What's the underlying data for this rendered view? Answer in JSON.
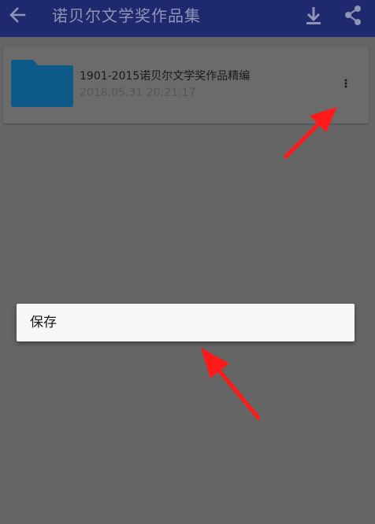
{
  "appbar": {
    "title": "诺贝尔文学奖作品集",
    "back_icon": "arrow-left-icon",
    "download_icon": "download-icon",
    "share_icon": "share-icon"
  },
  "file_item": {
    "icon": "folder-icon",
    "name": "1901-2015诺贝尔文学奖作品精编",
    "date": "2018.05.31 20:21:17",
    "more_icon": "more-vert-icon"
  },
  "context_menu": {
    "items": [
      {
        "label": "保存"
      }
    ]
  },
  "colors": {
    "appbar": "#1f2a6e",
    "scrim_background": "#656565",
    "folder": "#0d5a88",
    "annotation_arrow": "#ff1a1a"
  }
}
